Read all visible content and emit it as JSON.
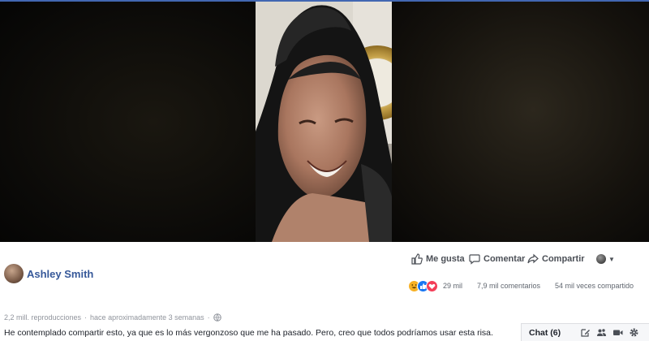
{
  "post": {
    "author": "Ashley Smith",
    "actions": {
      "like": "Me gusta",
      "comment": "Comentar",
      "share": "Compartir"
    },
    "stats": {
      "reactions": "29 mil",
      "comments": "7,9 mil comentarios",
      "shares": "54 mil veces compartido"
    },
    "views": "2,2 mill. reproducciones",
    "separator": "·",
    "time": "hace aproximadamente 3 semanas",
    "caption": "He contemplado compartir esto, ya que es lo más vergonzoso que me ha pasado. Pero, creo que todos podríamos usar esta risa."
  },
  "reaction_icons": [
    "haha-icon",
    "like-icon",
    "love-icon"
  ],
  "chat": {
    "label": "Chat (6)"
  },
  "colors": {
    "brand": "#4267b2",
    "link": "#365899",
    "like": "#1877f2",
    "love": "#f33e58",
    "haha": "#f7b125"
  }
}
